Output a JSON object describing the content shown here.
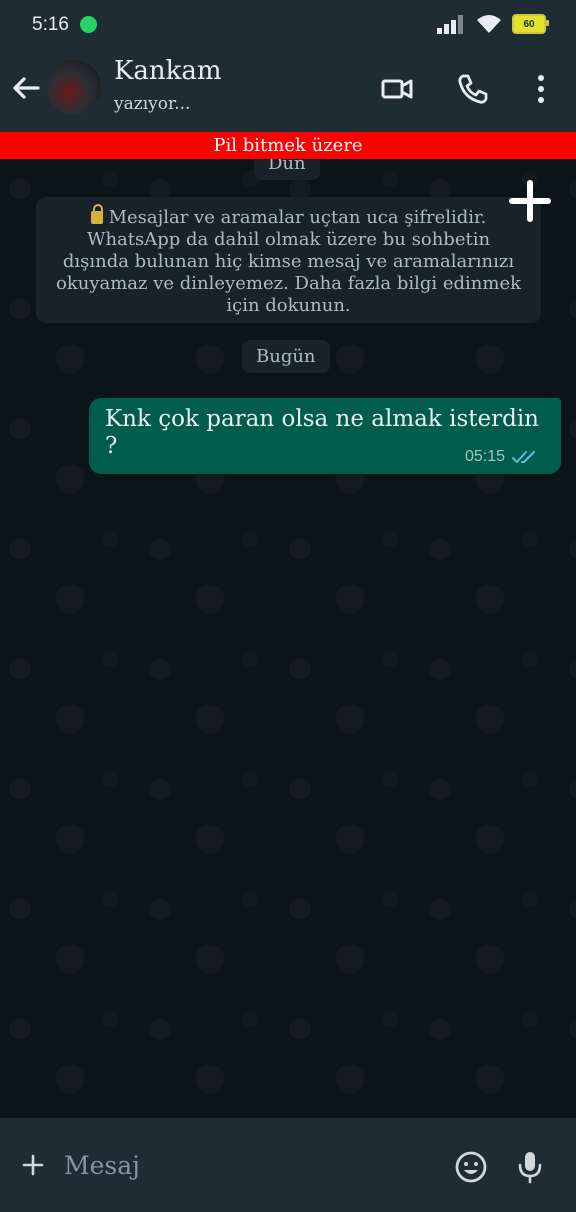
{
  "status_bar": {
    "time": "5:16",
    "battery": "60"
  },
  "header": {
    "contact_name": "Kankam",
    "contact_status": "yazıyor..."
  },
  "banner": {
    "text": "Pil bitmek üzere"
  },
  "chat": {
    "date_yesterday": "Dün",
    "encryption_notice": "Mesajlar ve aramalar uçtan uca şifrelidir. WhatsApp da dahil olmak üzere bu sohbetin dışında bulunan hiç kimse mesaj ve aramalarınızı okuyamaz ve dinleyemez. Daha fazla bilgi edinmek için dokunun.",
    "date_today": "Bugün",
    "messages": [
      {
        "direction": "outgoing",
        "text": "Knk çok paran olsa ne almak isterdin ?",
        "time": "05:15",
        "status": "read"
      }
    ]
  },
  "input": {
    "placeholder": "Mesaj"
  },
  "colors": {
    "header_bg": "#1f2c33",
    "chat_bg": "#0b1418",
    "outgoing_bubble": "#005c4b",
    "banner_bg": "#ff0000",
    "read_ticks": "#53bdeb"
  }
}
